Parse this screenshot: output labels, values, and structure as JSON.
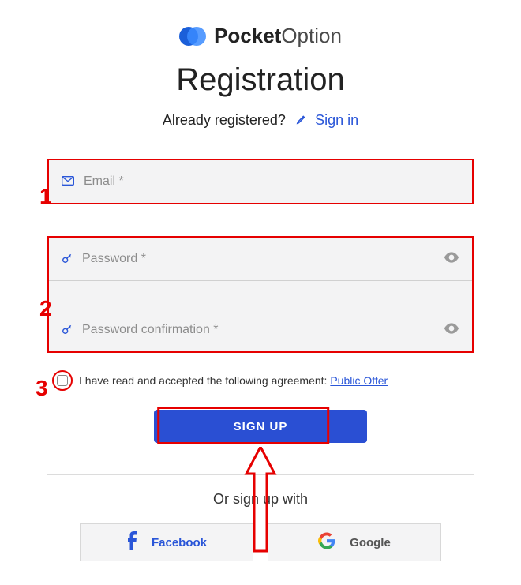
{
  "brand": {
    "bold": "Pocket",
    "light": "Option"
  },
  "title": "Registration",
  "already": {
    "text": "Already registered?",
    "link": "Sign in"
  },
  "fields": {
    "email": {
      "placeholder": "Email *"
    },
    "password": {
      "placeholder": "Password *"
    },
    "confirm": {
      "placeholder": "Password confirmation *"
    }
  },
  "agreement": {
    "text": "I have read and accepted the following agreement: ",
    "link": "Public Offer"
  },
  "signup": "SIGN UP",
  "or": "Or sign up with",
  "social": {
    "facebook": "Facebook",
    "google": "Google"
  },
  "annotations": {
    "n1": "1",
    "n2": "2",
    "n3": "3"
  }
}
